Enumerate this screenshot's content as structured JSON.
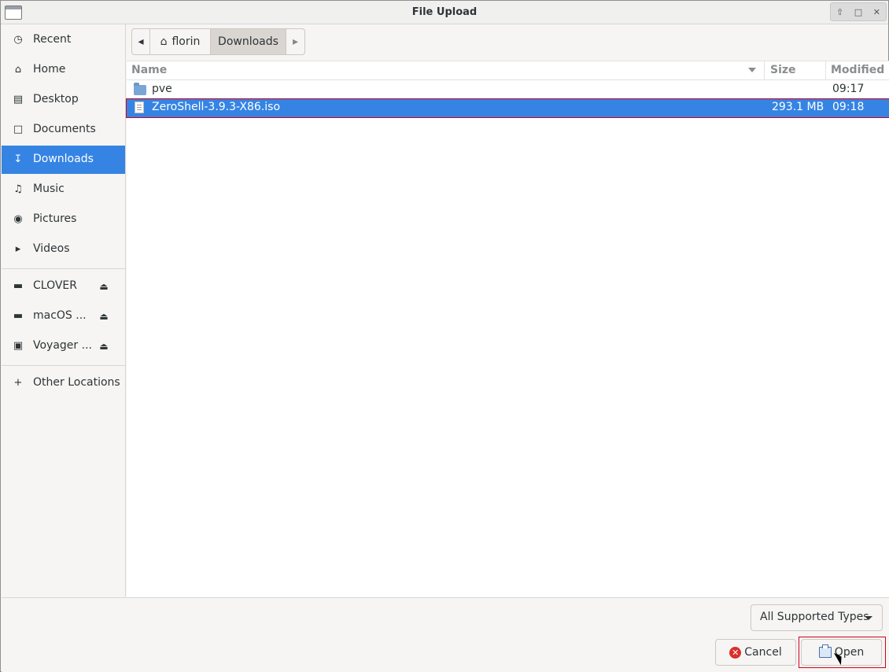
{
  "window": {
    "title": "File Upload"
  },
  "sidebar": {
    "items": [
      {
        "label": "Recent",
        "icon": "clock-icon"
      },
      {
        "label": "Home",
        "icon": "home-icon"
      },
      {
        "label": "Desktop",
        "icon": "folder-icon"
      },
      {
        "label": "Documents",
        "icon": "document-icon"
      },
      {
        "label": "Downloads",
        "icon": "download-icon",
        "active": true
      },
      {
        "label": "Music",
        "icon": "music-icon"
      },
      {
        "label": "Pictures",
        "icon": "camera-icon"
      },
      {
        "label": "Videos",
        "icon": "video-icon"
      }
    ],
    "devices": [
      {
        "label": "CLOVER",
        "icon": "drive-icon"
      },
      {
        "label": "macOS ...",
        "icon": "drive-icon"
      },
      {
        "label": "Voyager ...",
        "icon": "disk-icon"
      }
    ],
    "other_locations": "Other Locations"
  },
  "pathbar": {
    "home": "florin",
    "current": "Downloads"
  },
  "filelist": {
    "columns": {
      "name": "Name",
      "size": "Size",
      "modified": "Modified"
    },
    "rows": [
      {
        "name": "pve",
        "size": "",
        "modified": "09:17",
        "type": "folder"
      },
      {
        "name": "ZeroShell-3.9.3-X86.iso",
        "size": "293.1 MB",
        "modified": "09:18",
        "type": "file",
        "selected": true
      }
    ]
  },
  "bottom": {
    "filter": "All Supported Types",
    "cancel": "Cancel",
    "open": "Open"
  },
  "colors": {
    "accent": "#3584e4",
    "highlight_border": "#d0021b"
  }
}
